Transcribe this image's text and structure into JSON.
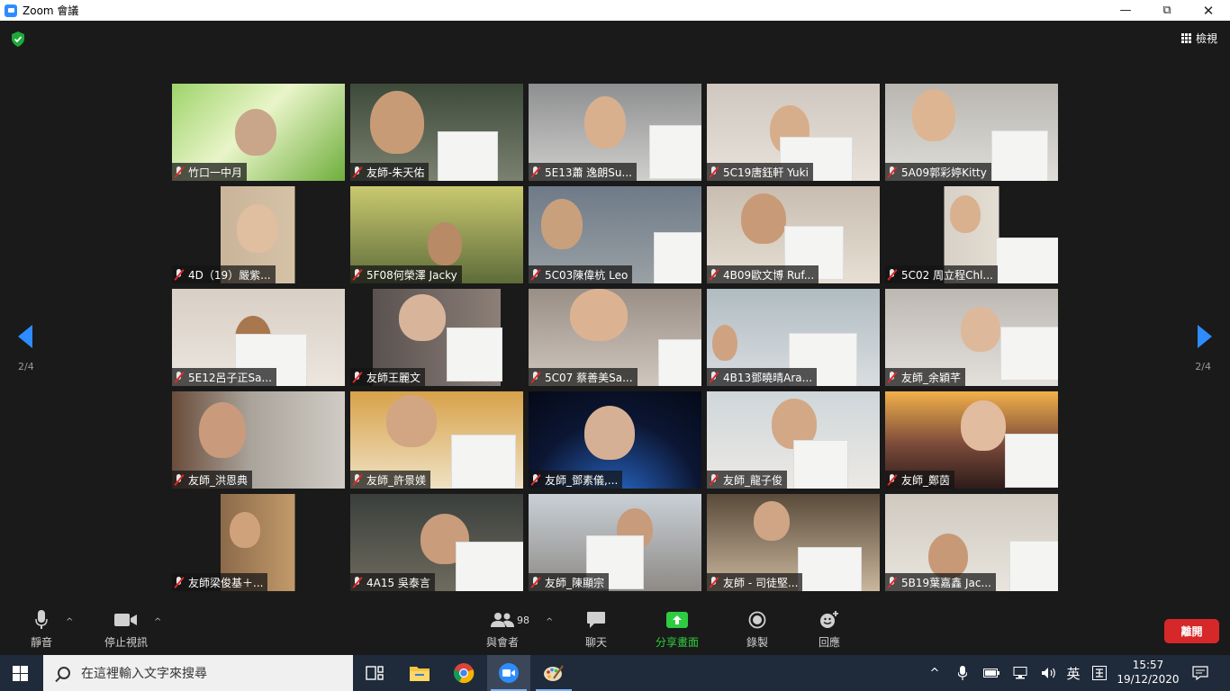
{
  "window": {
    "title": "Zoom 會議"
  },
  "meeting": {
    "view_label": "檢視",
    "page_left": "2/4",
    "page_right": "2/4"
  },
  "participants": [
    "竹口一中月",
    "友師-朱天佑",
    "5E13蕭 逸朗Su...",
    "5C19唐鈺軒 Yuki",
    "5A09郭彩婷Kitty",
    "4D（19）嚴紫...",
    "5F08何榮澤 Jacky",
    "5C03陳偉杭 Leo",
    "4B09歐文博 Ruf...",
    "5C02 周立程Chl...",
    "5E12呂子正Sa...",
    "友師王麗文",
    "5C07 蔡善美Sa...",
    "4B13鄧曉晴Ara...",
    "友師_余穎芊",
    "友師_洪恩典",
    "友師_許景媄",
    "友師_鄧素儀,...",
    "友師_龍子俊",
    "友師_鄭茵",
    "友師梁俊基＋...",
    "4A15 吳泰言",
    "友師_陳顯宗",
    "友師 - 司徒堅...",
    "5B19葉嘉鑫 Jac..."
  ],
  "toolbar": {
    "mute": "靜音",
    "stop_video": "停止視訊",
    "participants": "與會者",
    "participants_count": "98",
    "chat": "聊天",
    "share": "分享畫面",
    "record": "錄製",
    "reactions": "回應",
    "leave": "離開"
  },
  "taskbar": {
    "search_placeholder": "在這裡輸入文字來搜尋",
    "ime": "英",
    "time": "15:57",
    "date": "19/12/2020"
  },
  "colors": {
    "accent": "#2d8cff",
    "share_green": "#2ecc40",
    "leave_red": "#d62828"
  }
}
